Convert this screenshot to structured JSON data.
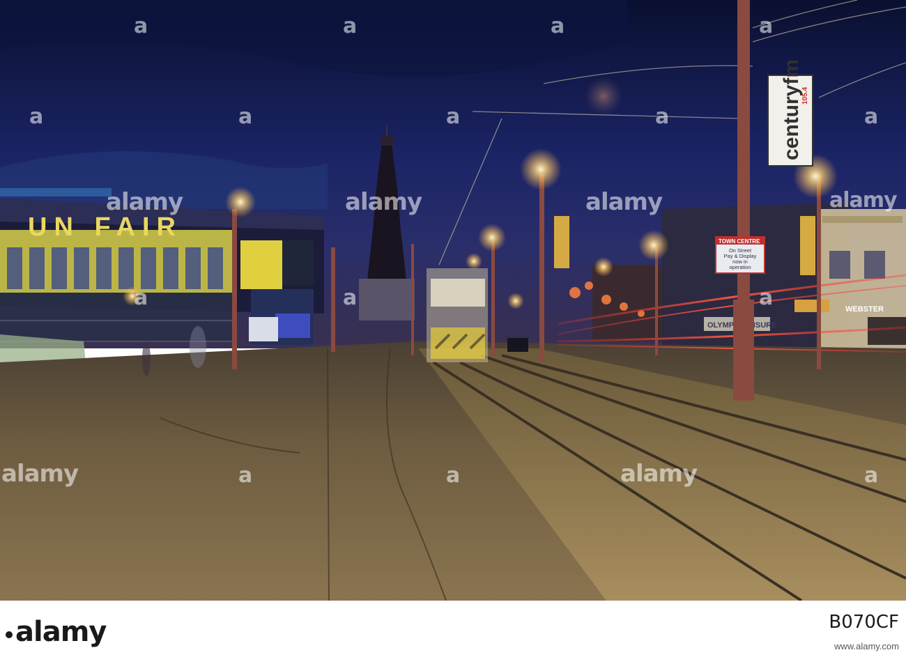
{
  "scene": {
    "description_tags": [
      "night-promenade",
      "tower",
      "tram-tracks",
      "street-lights",
      "light-trails"
    ]
  },
  "signs": {
    "fun_fair_letters": "UN  FAIR",
    "radio_frequency": "105.4",
    "radio_name": "centuryfm",
    "town_centre_title": "TOWN CENTRE",
    "town_centre_body": "On Street\nPay & Display\nnow in\noperation",
    "webster_sign": "WEBSTER",
    "olympia_sign": "OLYMPIA LEISURE"
  },
  "watermarks": {
    "word": "alamy",
    "count": 15
  },
  "footer": {
    "logo": "alamy",
    "image_id": "B070CF",
    "website": "www.alamy.com"
  },
  "colors": {
    "sky_top": "#0c1434",
    "sky_mid": "#1a2460",
    "road": "#6b5a3c",
    "lamp_glow": "#ffd27a"
  }
}
